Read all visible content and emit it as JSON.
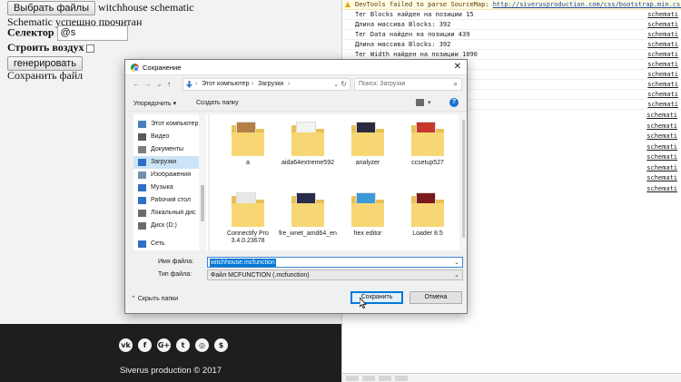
{
  "webpage": {
    "file_button": "Выбрать файлы",
    "file_name": "witchhouse schematic",
    "status": "Schematic успешно прочитан",
    "selector_label": "Селектор",
    "selector_value": "@s",
    "build_air_label": "Строить воздух",
    "generate_button": "генерировать",
    "save_file_label": "Сохранить файл",
    "social_icons": [
      {
        "name": "vk-icon",
        "glyph": "vk"
      },
      {
        "name": "facebook-icon",
        "glyph": "f"
      },
      {
        "name": "google-plus-icon",
        "glyph": "G+"
      },
      {
        "name": "twitter-icon",
        "glyph": "t"
      },
      {
        "name": "instagram-icon",
        "glyph": "◎"
      },
      {
        "name": "dollar-icon",
        "glyph": "$"
      }
    ],
    "copyright": "Siverus production © 2017"
  },
  "devtools": {
    "warning_prefix": "DevTools failed to parse SourceMap: ",
    "warning_link": "http://siverusproduction.com/css/bootstrap.min.css.map",
    "lines": [
      {
        "text": "Тег  Blocks  найден на позиции  15",
        "source": "schemati"
      },
      {
        "text": "Длина массива Blocks:  392",
        "source": "schemati"
      },
      {
        "text": "Тег  Data  найден на позиции  439",
        "source": "schemati"
      },
      {
        "text": "Длина массива Blocks:  392",
        "source": "schemati"
      },
      {
        "text": "Тег  Width  найден на позиции  1090",
        "source": "schemati"
      },
      {
        "text": "1047",
        "source": "schemati"
      },
      {
        "text": "972",
        "source": "schemati"
      },
      {
        "text": "983",
        "source": "schemati"
      },
      {
        "text": "999",
        "source": "schemati"
      },
      {
        "text": "1031",
        "source": "schemati"
      }
    ],
    "extra_sources": [
      "schemati",
      "schemati",
      "schemati",
      "schemati",
      "schemati",
      "schemati",
      "schemati",
      "schemati"
    ]
  },
  "dialog": {
    "title": "Сохранение",
    "breadcrumbs": [
      "Этот компьютер",
      "Загрузки"
    ],
    "search_placeholder": "Поиск: Загрузки",
    "organize_label": "Упорядочить ▾",
    "new_folder_label": "Создать папку",
    "help_glyph": "?",
    "nav_items": [
      {
        "label": "Этот компьютер",
        "icon": "computer-icon",
        "color": "#4a7fb8",
        "selected": false
      },
      {
        "label": "Видео",
        "icon": "video-icon",
        "color": "#5b5b5b",
        "selected": false
      },
      {
        "label": "Документы",
        "icon": "documents-icon",
        "color": "#7d7d7d",
        "selected": false
      },
      {
        "label": "Загрузки",
        "icon": "downloads-icon",
        "color": "#2f6fc4",
        "selected": true
      },
      {
        "label": "Изображения",
        "icon": "pictures-icon",
        "color": "#6f8fb0",
        "selected": false
      },
      {
        "label": "Музыка",
        "icon": "music-icon",
        "color": "#2f6fc4",
        "selected": false
      },
      {
        "label": "Рабочий стол",
        "icon": "desktop-icon",
        "color": "#2f6fc4",
        "selected": false
      },
      {
        "label": "Локальный дис",
        "icon": "drive-icon",
        "color": "#6b6b6b",
        "selected": false
      },
      {
        "label": "Диск (D:)",
        "icon": "drive-icon",
        "color": "#6b6b6b",
        "selected": false
      },
      {
        "label": "Сеть",
        "icon": "network-icon",
        "color": "#2f6fc4",
        "selected": false
      }
    ],
    "files": [
      {
        "name": "a",
        "kind": "folder",
        "accent": "#b57f45"
      },
      {
        "name": "aida64extreme592",
        "kind": "folder",
        "accent": "#f4f4f4"
      },
      {
        "name": "analyzer",
        "kind": "folder",
        "accent": "#2b2b40"
      },
      {
        "name": "ccsetup527",
        "kind": "folder",
        "accent": "#c7372c"
      },
      {
        "name": "Connectify Pro 3.4.0.23678",
        "kind": "folder",
        "accent": "#e8e8e8"
      },
      {
        "name": "fre_wnet_amd64_en",
        "kind": "folder",
        "accent": "#2a2a4a"
      },
      {
        "name": "hex editor",
        "kind": "folder",
        "accent": "#3a9bd6"
      },
      {
        "name": "Loader 8.5",
        "kind": "folder",
        "accent": "#7a1a1a"
      }
    ],
    "filename_label": "Имя файла:",
    "filename_value": "witchhouse.mcfunction",
    "filetype_label": "Тип файла:",
    "filetype_value": "Файл MCFUNCTION (.mcfunction)",
    "hide_folders_label": "Скрыть папки",
    "save_button": "Сохранить",
    "cancel_button": "Отмена"
  }
}
